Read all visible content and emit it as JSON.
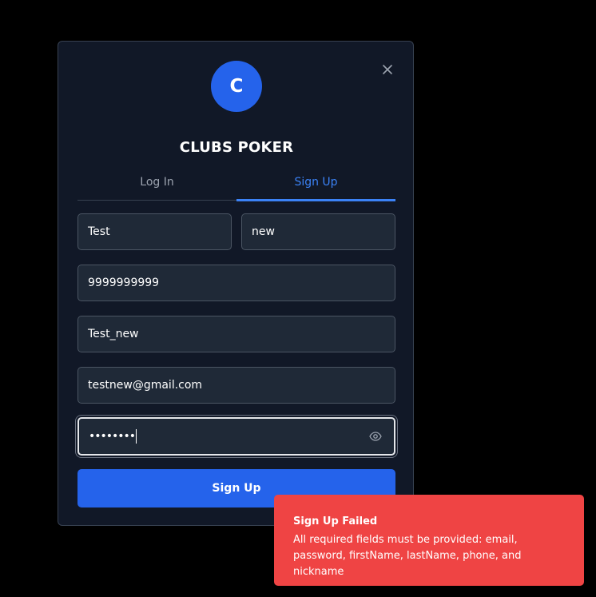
{
  "modal": {
    "avatar_letter": "C",
    "title": "CLUBS POKER",
    "tabs": [
      {
        "label": "Log In",
        "active": false
      },
      {
        "label": "Sign Up",
        "active": true
      }
    ],
    "fields": {
      "first_name": "Test",
      "last_name": "new",
      "phone": "9999999999",
      "nickname": "Test_new",
      "email": "testnew@gmail.com",
      "password_masked": "••••••••"
    },
    "submit_label": "Sign Up"
  },
  "toast": {
    "title": "Sign Up Failed",
    "message": "All required fields must be provided: email, password, firstName, lastName, phone, and nickname"
  },
  "colors": {
    "accent": "#2563eb",
    "tab_active": "#3b82f6",
    "error": "#ef4444",
    "modal_bg": "#111827",
    "field_bg": "#1f2937"
  },
  "icons": {
    "close": "close-icon",
    "password_toggle": "eye-icon"
  }
}
